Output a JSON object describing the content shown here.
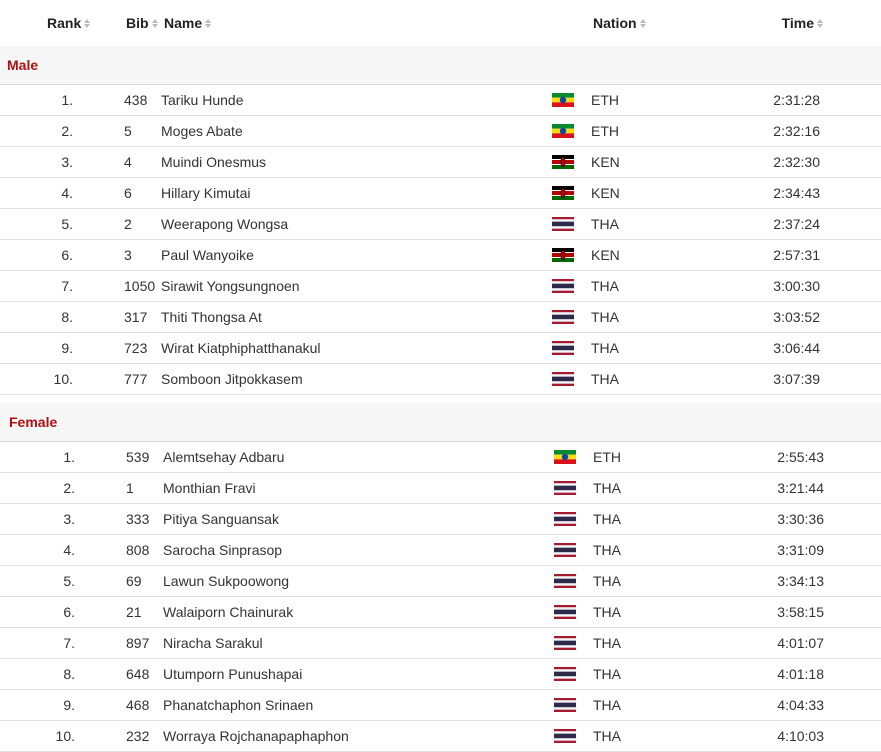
{
  "columns": {
    "rank": "Rank",
    "bib": "Bib",
    "name": "Name",
    "nation": "Nation",
    "time": "Time"
  },
  "groups": [
    {
      "title": "Male",
      "rows": [
        {
          "rank": "1.",
          "bib": "438",
          "name": "Tariku Hunde",
          "nation": "ETH",
          "time": "2:31:28",
          "flag": "eth-flag-icon"
        },
        {
          "rank": "2.",
          "bib": "5",
          "name": "Moges Abate",
          "nation": "ETH",
          "time": "2:32:16",
          "flag": "eth-flag-icon"
        },
        {
          "rank": "3.",
          "bib": "4",
          "name": "Muindi Onesmus",
          "nation": "KEN",
          "time": "2:32:30",
          "flag": "ken-flag-icon"
        },
        {
          "rank": "4.",
          "bib": "6",
          "name": "Hillary Kimutai",
          "nation": "KEN",
          "time": "2:34:43",
          "flag": "ken-flag-icon"
        },
        {
          "rank": "5.",
          "bib": "2",
          "name": "Weerapong Wongsa",
          "nation": "THA",
          "time": "2:37:24",
          "flag": "tha-flag-icon"
        },
        {
          "rank": "6.",
          "bib": "3",
          "name": "Paul Wanyoike",
          "nation": "KEN",
          "time": "2:57:31",
          "flag": "ken-flag-icon"
        },
        {
          "rank": "7.",
          "bib": "1050",
          "name": "Sirawit Yongsungnoen",
          "nation": "THA",
          "time": "3:00:30",
          "flag": "tha-flag-icon"
        },
        {
          "rank": "8.",
          "bib": "317",
          "name": "Thiti Thongsa At",
          "nation": "THA",
          "time": "3:03:52",
          "flag": "tha-flag-icon"
        },
        {
          "rank": "9.",
          "bib": "723",
          "name": "Wirat Kiatphiphatthanakul",
          "nation": "THA",
          "time": "3:06:44",
          "flag": "tha-flag-icon"
        },
        {
          "rank": "10.",
          "bib": "777",
          "name": "Somboon Jitpokkasem",
          "nation": "THA",
          "time": "3:07:39",
          "flag": "tha-flag-icon"
        }
      ]
    },
    {
      "title": "Female",
      "rows": [
        {
          "rank": "1.",
          "bib": "539",
          "name": "Alemtsehay Adbaru",
          "nation": "ETH",
          "time": "2:55:43",
          "flag": "eth-flag-icon"
        },
        {
          "rank": "2.",
          "bib": "1",
          "name": "Monthian Fravi",
          "nation": "THA",
          "time": "3:21:44",
          "flag": "tha-flag-icon"
        },
        {
          "rank": "3.",
          "bib": "333",
          "name": "Pitiya Sanguansak",
          "nation": "THA",
          "time": "3:30:36",
          "flag": "tha-flag-icon"
        },
        {
          "rank": "4.",
          "bib": "808",
          "name": "Sarocha Sinprasop",
          "nation": "THA",
          "time": "3:31:09",
          "flag": "tha-flag-icon"
        },
        {
          "rank": "5.",
          "bib": "69",
          "name": "Lawun Sukpoowong",
          "nation": "THA",
          "time": "3:34:13",
          "flag": "tha-flag-icon"
        },
        {
          "rank": "6.",
          "bib": "21",
          "name": "Walaiporn Chainurak",
          "nation": "THA",
          "time": "3:58:15",
          "flag": "tha-flag-icon"
        },
        {
          "rank": "7.",
          "bib": "897",
          "name": "Niracha Sarakul",
          "nation": "THA",
          "time": "4:01:07",
          "flag": "tha-flag-icon"
        },
        {
          "rank": "8.",
          "bib": "648",
          "name": "Utumporn Punushapai",
          "nation": "THA",
          "time": "4:01:18",
          "flag": "tha-flag-icon"
        },
        {
          "rank": "9.",
          "bib": "468",
          "name": "Phanatchaphon Srinaen",
          "nation": "THA",
          "time": "4:04:33",
          "flag": "tha-flag-icon"
        },
        {
          "rank": "10.",
          "bib": "232",
          "name": "Worraya Rojchanapaphaphon",
          "nation": "THA",
          "time": "4:10:03",
          "flag": "tha-flag-icon"
        }
      ]
    }
  ],
  "colors": {
    "group_title": "#b01010",
    "header_bg": "#f7f7f7",
    "row_border": "#e2e2e2"
  }
}
